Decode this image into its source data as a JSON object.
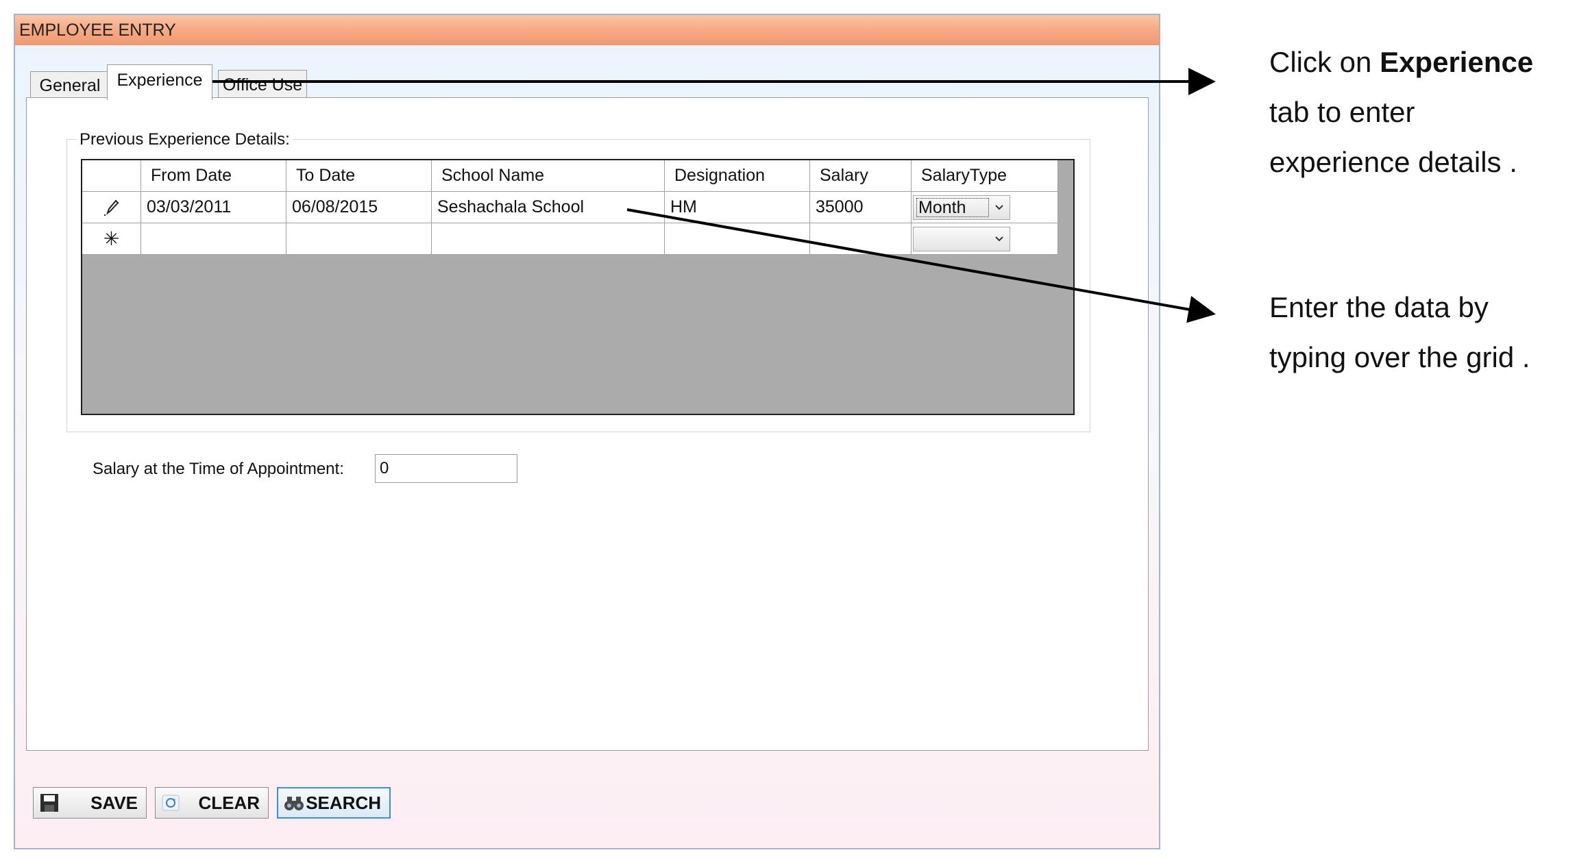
{
  "window": {
    "title": "EMPLOYEE ENTRY"
  },
  "tabs": [
    {
      "label": "General",
      "active": false
    },
    {
      "label": "Experience",
      "active": true
    },
    {
      "label": "Office Use",
      "active": false
    }
  ],
  "experience": {
    "group_title": "Previous Experience Details:",
    "columns": [
      "From Date",
      "To Date",
      "School Name",
      "Designation",
      "Salary",
      "SalaryType"
    ],
    "rows": [
      {
        "from_date": "03/03/2011",
        "to_date": "06/08/2015",
        "school_name": "Seshachala School",
        "designation": "HM",
        "salary": "35000",
        "salary_type": "Month"
      }
    ],
    "editing_row_icon": "pencil-icon",
    "new_row_icon": "asterisk-icon",
    "new_row_glyph": "✳"
  },
  "salary_appointment": {
    "label": "Salary at the Time of Appointment:",
    "value": "0"
  },
  "buttons": {
    "save": "SAVE",
    "clear": "CLEAR",
    "search": "SEARCH"
  },
  "annotations": {
    "experience_tab": {
      "prefix": "Click on ",
      "bold": "Experience",
      "line2": "tab to enter",
      "line3": "experience  details ."
    },
    "grid": {
      "line1": "Enter the data by",
      "line2": "typing over the grid ."
    }
  },
  "colors": {
    "titlebar": "#f6a783",
    "grid_background": "#ababab",
    "search_border": "#3c8fd6"
  }
}
